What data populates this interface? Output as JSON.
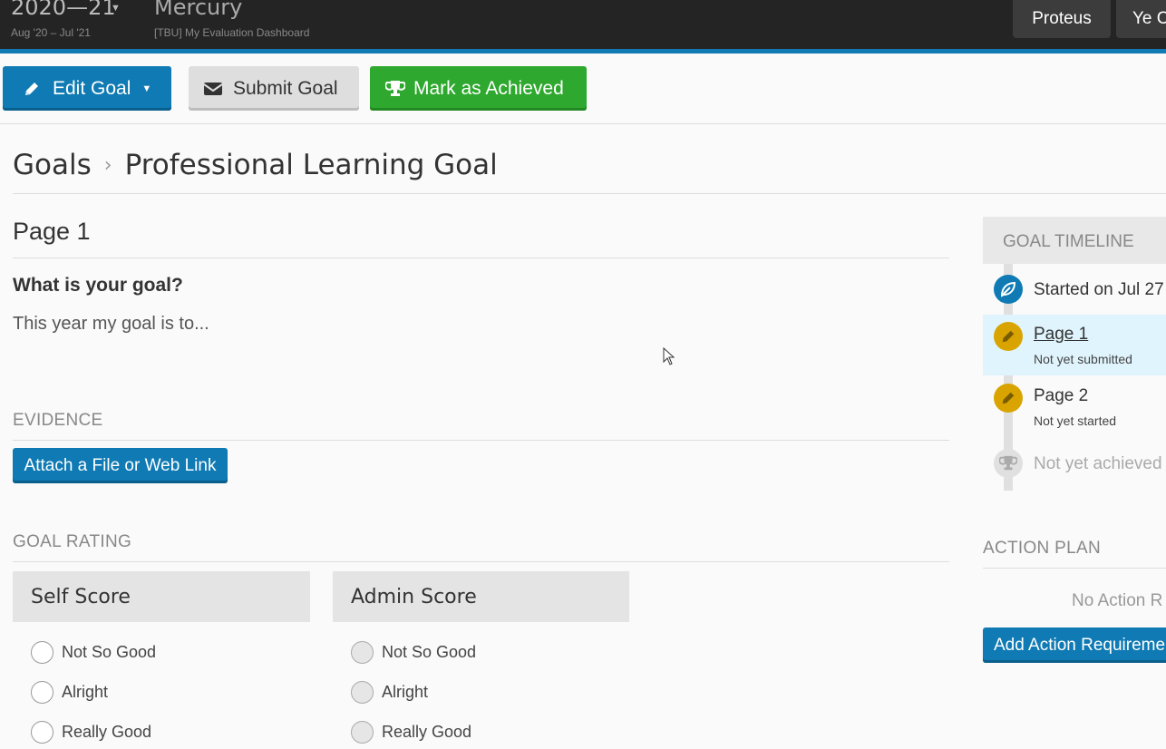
{
  "header": {
    "year_title": "2020—21",
    "year_range": "Aug '20 – Jul '21",
    "app_title": "Mercury",
    "app_subtitle": "[TBU] My Evaluation Dashboard",
    "buttons": [
      "Proteus",
      "Ye C"
    ]
  },
  "toolbar": {
    "edit_label": "Edit Goal",
    "submit_label": "Submit Goal",
    "achieve_label": "Mark as Achieved"
  },
  "breadcrumb": {
    "root": "Goals",
    "separator": "›",
    "current": "Professional Learning Goal"
  },
  "main": {
    "page_heading": "Page 1",
    "question": "What is your goal?",
    "answer": "This year my goal is to...",
    "evidence_label": "EVIDENCE",
    "attach_label": "Attach a File or Web Link",
    "rating_label": "GOAL RATING",
    "self_score": {
      "title": "Self Score",
      "options": [
        "Not So Good",
        "Alright",
        "Really Good"
      ]
    },
    "admin_score": {
      "title": "Admin Score",
      "options": [
        "Not So Good",
        "Alright",
        "Really Good"
      ]
    }
  },
  "timeline": {
    "title": "GOAL TIMELINE",
    "items": [
      {
        "label": "Started on Jul 27",
        "sub": ""
      },
      {
        "label": "Page 1",
        "sub": "Not yet submitted"
      },
      {
        "label": "Page 2",
        "sub": "Not yet started"
      },
      {
        "label": "Not yet achieved",
        "sub": ""
      }
    ]
  },
  "action_plan": {
    "title": "ACTION PLAN",
    "empty_text": "No Action R",
    "add_label": "Add Action Requireme"
  },
  "colors": {
    "primary": "#0f7ab3",
    "success": "#2ea82e",
    "warning": "#d9a400",
    "header_bg": "#242424"
  }
}
